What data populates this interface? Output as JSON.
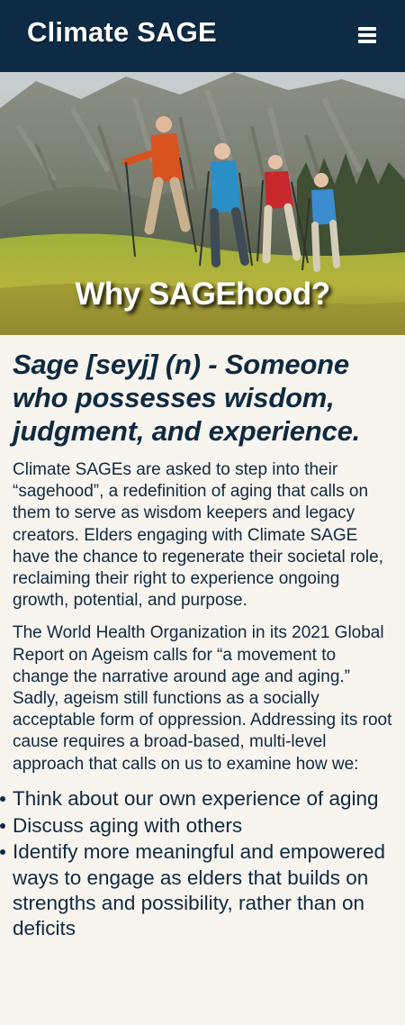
{
  "header": {
    "brand": "Climate SAGE",
    "menu_icon": "hamburger-menu-icon"
  },
  "hero": {
    "title": "Why SAGEhood?",
    "image": "hikers-on-mountain-meadow"
  },
  "main": {
    "definition": "Sage [seyj] (n) - Someone who possesses wisdom, judgment, and experience.",
    "paragraphs": [
      "Climate SAGEs are asked to step into their “sagehood”, a redefinition of aging that calls on them to serve as wisdom keepers and legacy creators. Elders engaging with Climate SAGE have the chance to regenerate their societal role, reclaiming their right to experience ongoing growth, potential, and purpose.",
      "The World Health Organization in its 2021 Global Report on Ageism calls for “a movement to change the narrative around age and aging.” Sadly, ageism still functions as a socially acceptable form of oppression. Addressing its root cause requires a broad-based, multi-level approach that calls on us to examine how we:"
    ],
    "bullets": [
      "Think about our own experience of aging",
      "Discuss aging with others",
      "Identify more meaningful and empowered ways to engage as elders that builds on strengths and possibility, rather than on deficits"
    ]
  },
  "colors": {
    "header_bg": "#0d2b44",
    "page_bg": "#f8f4ee",
    "text": "#0f2a40"
  }
}
